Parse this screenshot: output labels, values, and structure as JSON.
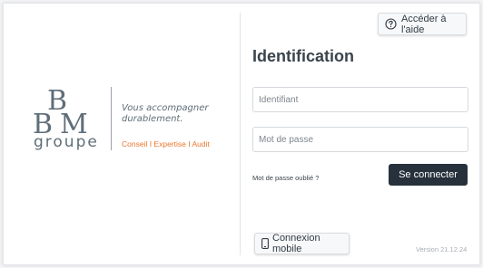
{
  "help": {
    "label": "Accéder à l'aide",
    "icon": "question-circle-icon"
  },
  "brand": {
    "logo_letters": "BBM",
    "logo_word": "groupe",
    "tagline_line1": "Vous accompagner",
    "tagline_line2": "durablement.",
    "services": "Conseil I Expertise I Audit",
    "colors": {
      "logo": "#5f6e78",
      "accent": "#e8772e"
    }
  },
  "login": {
    "title": "Identification",
    "username_placeholder": "Identifiant",
    "password_placeholder": "Mot de passe",
    "forgot_label": "Mot de passe oublié ?",
    "submit_label": "Se connecter",
    "submit_color": "#26313b"
  },
  "mobile": {
    "label": "Connexion mobile",
    "icon": "smartphone-icon"
  },
  "version": "Version 21.12.24"
}
